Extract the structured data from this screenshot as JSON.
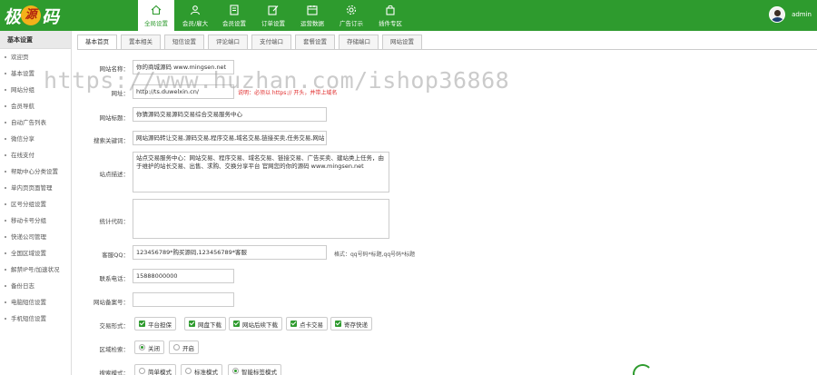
{
  "logo": {
    "left": "极",
    "coin": "源",
    "right": "码"
  },
  "nav": [
    {
      "label": "全局设置",
      "icon": "home-icon"
    },
    {
      "label": "会员/雇大",
      "icon": "user-icon"
    },
    {
      "label": "会员设置",
      "icon": "page-icon"
    },
    {
      "label": "订单设置",
      "icon": "pen-icon"
    },
    {
      "label": "运营数据",
      "icon": "calendar-icon"
    },
    {
      "label": "广告订示",
      "icon": "gear-icon"
    },
    {
      "label": "插件专区",
      "icon": "bag-icon"
    }
  ],
  "user": {
    "name": "admin"
  },
  "sidebar": {
    "title": "基本设置",
    "items": [
      "欢迎页",
      "基本设置",
      "网站分组",
      "会员导航",
      "自动广告列表",
      "微信分享",
      "在线支付",
      "帮助中心分类设置",
      "单内页页面管理",
      "区号分组设置",
      "移动卡号分组",
      "快递公司管理",
      "全国区域设置",
      "解禁IP号/加速状况",
      "备份日志",
      "电脑短信设置",
      "手机短信设置"
    ]
  },
  "tabs": [
    "基本首页",
    "置本相关",
    "短信设置",
    "评论端口",
    "支付端口",
    "套餐设置",
    "存储端口",
    "网站设置"
  ],
  "form": {
    "site_name": {
      "label": "网站名称：",
      "value": "你的商城源码 www.mingsen.net"
    },
    "site_url": {
      "label": "网址：",
      "value": "http://ts.duwelxin.cn/",
      "hint": "说明：必须以 https:// 开头，并带上域名"
    },
    "site_title": {
      "label": "网站标题：",
      "value": "你猜源码交易源码交易综合交易服务中心"
    },
    "keywords": {
      "label": "搜索关键词：",
      "value": "网站源码转让交易,源码交易,程序交易,域名交易,链接买卖,任务交易,网站"
    },
    "description": {
      "label": "站点描述：",
      "value": "站点交易服务中心：网站交易、程序交易、域名交易、链接交易、广告买卖、建站类上任务，由于维护的站长交易、出售、求购、交换分享平台 官网您的你的源码 www.mingsen.net"
    },
    "stats_code": {
      "label": "统计代码：",
      "value": ""
    },
    "qq": {
      "label": "客服QQ：",
      "value": "123456789*购买源码,123456789*客服",
      "hint": "格式：qq号码*标题,qq号码*标题"
    },
    "phone": {
      "label": "联系电话：",
      "value": "15888000000"
    },
    "icp": {
      "label": "网站备案号：",
      "value": ""
    },
    "trade_types": {
      "label": "交易形式：",
      "options": [
        "平台担保",
        "网盘下载",
        "网站后续下载",
        "点卡交易",
        "寄存快递"
      ]
    },
    "region_limit": {
      "label": "区域检索：",
      "options": [
        "关闭",
        "开启"
      ],
      "selected": "关闭"
    },
    "search_mode": {
      "label": "搜索模式：",
      "options": [
        "简单模式",
        "标准模式",
        "智能标签模式"
      ],
      "selected": "智能标签模式"
    }
  },
  "watermark": "https://www.huzhan.com/ishop36868",
  "colors": {
    "brand": "#2e9b2e",
    "hint_red": "#e02b2b"
  }
}
